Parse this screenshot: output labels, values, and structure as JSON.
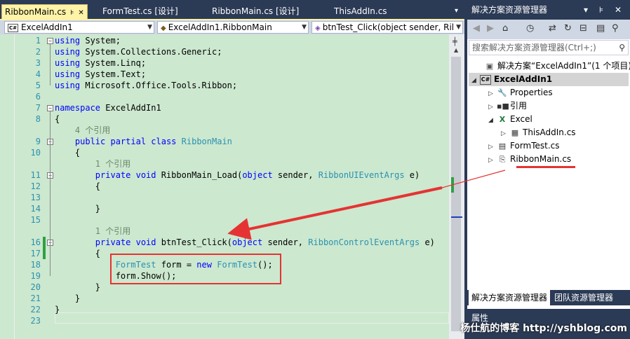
{
  "tabs": [
    {
      "label": "RibbonMain.cs",
      "active": true,
      "pin": "⊧",
      "close": "✕"
    },
    {
      "label": "FormTest.cs [设计]"
    },
    {
      "label": "RibbonMain.cs [设计]"
    },
    {
      "label": "ThisAddIn.cs"
    }
  ],
  "tab_overflow": "▾",
  "navbar": {
    "project": "ExcelAddIn1",
    "class": "ExcelAddIn1.RibbonMain",
    "member": "btnTest_Click(object sender, Ril"
  },
  "code_lines": [
    {
      "num": "1",
      "tokens": [
        [
          "kw",
          "using"
        ],
        [
          "pl",
          " System;"
        ]
      ]
    },
    {
      "num": "2",
      "tokens": [
        [
          "kw",
          "using"
        ],
        [
          "pl",
          " System.Collections.Generic;"
        ]
      ]
    },
    {
      "num": "3",
      "tokens": [
        [
          "kw",
          "using"
        ],
        [
          "pl",
          " System.Linq;"
        ]
      ]
    },
    {
      "num": "4",
      "tokens": [
        [
          "kw",
          "using"
        ],
        [
          "pl",
          " System.Text;"
        ]
      ]
    },
    {
      "num": "5",
      "tokens": [
        [
          "kw",
          "using"
        ],
        [
          "pl",
          " Microsoft.Office.Tools.Ribbon;"
        ]
      ]
    },
    {
      "num": "6",
      "tokens": []
    },
    {
      "num": "7",
      "tokens": [
        [
          "kw",
          "namespace"
        ],
        [
          "pl",
          " ExcelAddIn1"
        ]
      ]
    },
    {
      "num": "8",
      "tokens": [
        [
          "pl",
          "{"
        ]
      ]
    },
    {
      "num": "",
      "tokens": [
        [
          "rf",
          "    4 个引用"
        ]
      ]
    },
    {
      "num": "9",
      "tokens": [
        [
          "pl",
          "    "
        ],
        [
          "kw",
          "public partial class"
        ],
        [
          "pl",
          " "
        ],
        [
          "ty",
          "RibbonMain"
        ]
      ]
    },
    {
      "num": "10",
      "tokens": [
        [
          "pl",
          "    {"
        ]
      ]
    },
    {
      "num": "",
      "tokens": [
        [
          "rf",
          "        1 个引用"
        ]
      ]
    },
    {
      "num": "11",
      "tokens": [
        [
          "pl",
          "        "
        ],
        [
          "kw",
          "private void"
        ],
        [
          "pl",
          " RibbonMain_Load("
        ],
        [
          "kw",
          "object"
        ],
        [
          "pl",
          " sender, "
        ],
        [
          "ty",
          "RibbonUIEventArgs"
        ],
        [
          "pl",
          " e)"
        ]
      ]
    },
    {
      "num": "12",
      "tokens": [
        [
          "pl",
          "        {"
        ]
      ]
    },
    {
      "num": "13",
      "tokens": []
    },
    {
      "num": "14",
      "tokens": [
        [
          "pl",
          "        }"
        ]
      ]
    },
    {
      "num": "15",
      "tokens": []
    },
    {
      "num": "",
      "tokens": [
        [
          "rf",
          "        1 个引用"
        ]
      ]
    },
    {
      "num": "16",
      "tokens": [
        [
          "pl",
          "        "
        ],
        [
          "kw",
          "private void"
        ],
        [
          "pl",
          " btnTest_Click("
        ],
        [
          "kw",
          "object"
        ],
        [
          "pl",
          " sender, "
        ],
        [
          "ty",
          "RibbonControlEventArgs"
        ],
        [
          "pl",
          " e)"
        ]
      ]
    },
    {
      "num": "17",
      "tokens": [
        [
          "pl",
          "        {"
        ]
      ]
    },
    {
      "num": "18",
      "tokens": [
        [
          "pl",
          "            "
        ],
        [
          "ty",
          "FormTest"
        ],
        [
          "pl",
          " form = "
        ],
        [
          "kw",
          "new"
        ],
        [
          "pl",
          " "
        ],
        [
          "ty",
          "FormTest"
        ],
        [
          "pl",
          "();"
        ]
      ]
    },
    {
      "num": "19",
      "tokens": [
        [
          "pl",
          "            form.Show();"
        ]
      ]
    },
    {
      "num": "20",
      "tokens": [
        [
          "pl",
          "        }"
        ]
      ]
    },
    {
      "num": "21",
      "tokens": [
        [
          "pl",
          "    }"
        ]
      ]
    },
    {
      "num": "22",
      "tokens": [
        [
          "pl",
          "}"
        ]
      ]
    },
    {
      "num": "23",
      "tokens": []
    }
  ],
  "solution_explorer": {
    "title": "解决方案资源管理器",
    "title_buttons": "▾ ⊧ ✕",
    "search_placeholder": "搜索解决方案资源管理器(Ctrl+;)",
    "tree": [
      {
        "label": "解决方案“ExcelAddIn1”(1 个项目)",
        "icon": "solution-icon",
        "expander": ""
      },
      {
        "label": "ExcelAddIn1",
        "icon": "csharp-project-icon",
        "expander": "◢",
        "selected": true,
        "bold": true
      },
      {
        "label": "Properties",
        "icon": "wrench-icon",
        "expander": "▷"
      },
      {
        "label": "引用",
        "icon": "references-icon",
        "expander": "▷"
      },
      {
        "label": "Excel",
        "icon": "excel-icon",
        "expander": "◢"
      },
      {
        "label": "ThisAddIn.cs",
        "icon": "cs-file-icon",
        "expander": "▷"
      },
      {
        "label": "FormTest.cs",
        "icon": "form-icon",
        "expander": "▷"
      },
      {
        "label": "RibbonMain.cs",
        "icon": "ribbon-file-icon",
        "expander": "▷"
      }
    ],
    "bottom_tabs": [
      "解决方案资源管理器",
      "团队资源管理器"
    ]
  },
  "properties_title": "属性",
  "watermark": "杨仕航的博客 http://yshblog.com",
  "colors": {
    "editor_bg": "#cce8cf",
    "active_tab": "#fff3a8",
    "keyword": "#0000ff",
    "type": "#2b91af",
    "annotation": "#e53333"
  }
}
